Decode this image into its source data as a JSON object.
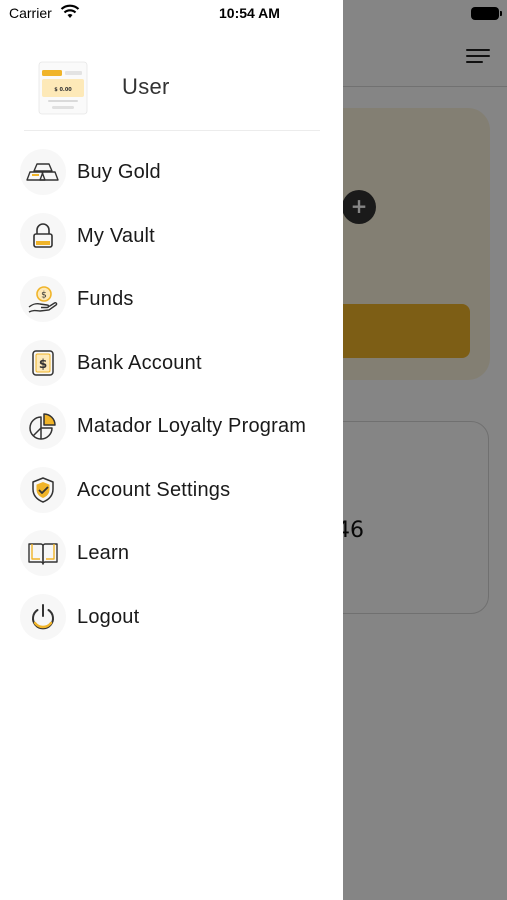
{
  "status_bar": {
    "carrier": "Carrier",
    "time": "10:54 AM"
  },
  "background": {
    "partial_balance_text": "46",
    "accent_color": "#f0b429"
  },
  "profile": {
    "username": "User",
    "avatar_card_amount": "$ 0.00"
  },
  "menu": {
    "items": [
      {
        "label": "Buy Gold",
        "icon": "gold-bars-icon"
      },
      {
        "label": "My Vault",
        "icon": "lock-icon"
      },
      {
        "label": "Funds",
        "icon": "hand-coin-icon"
      },
      {
        "label": "Bank Account",
        "icon": "dollar-document-icon"
      },
      {
        "label": "Matador Loyalty Program",
        "icon": "pie-chart-icon"
      },
      {
        "label": "Account Settings",
        "icon": "shield-check-icon"
      },
      {
        "label": "Learn",
        "icon": "open-book-icon"
      },
      {
        "label": "Logout",
        "icon": "power-icon"
      }
    ]
  },
  "colors": {
    "icon_accent": "#f0b429",
    "icon_stroke": "#333333",
    "overlay": "rgba(0,0,0,0.48)"
  }
}
